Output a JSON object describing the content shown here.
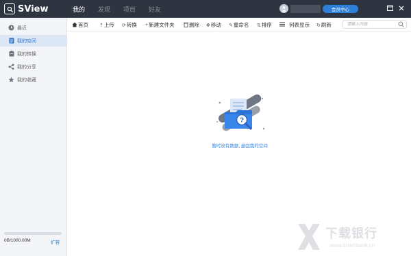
{
  "app": {
    "name": "SView"
  },
  "topnav": [
    "我的",
    "发现",
    "项目",
    "好友"
  ],
  "header": {
    "vip_button": "会员中心"
  },
  "sidebar": {
    "items": [
      {
        "label": "最近",
        "icon": "clock-icon"
      },
      {
        "label": "我的空间",
        "icon": "document-icon",
        "active": true
      },
      {
        "label": "我的转换",
        "icon": "clipboard-icon"
      },
      {
        "label": "我的分享",
        "icon": "share-icon"
      },
      {
        "label": "我的收藏",
        "icon": "star-icon"
      }
    ],
    "storage_text": "0B/1000.00M",
    "storage_used_fraction": 0,
    "expand_label": "扩容"
  },
  "toolbar": {
    "home": "首页",
    "upload": "上传",
    "convert": "转换",
    "new_folder": "新建文件夹",
    "delete": "删除",
    "move": "移动",
    "rename": "重命名",
    "sort": "排序",
    "list_view": "列表显示",
    "refresh": "刷新",
    "search_placeholder": "请输入内容"
  },
  "empty_state": {
    "message": "暂时没有数据, 返回我的空间"
  },
  "watermark": {
    "cn": "下载银行",
    "en": "www.downbank.cn"
  },
  "colors": {
    "titlebar": "#2f3540",
    "accent": "#2d7fd8",
    "sidebar_active": "#dde8f7"
  }
}
